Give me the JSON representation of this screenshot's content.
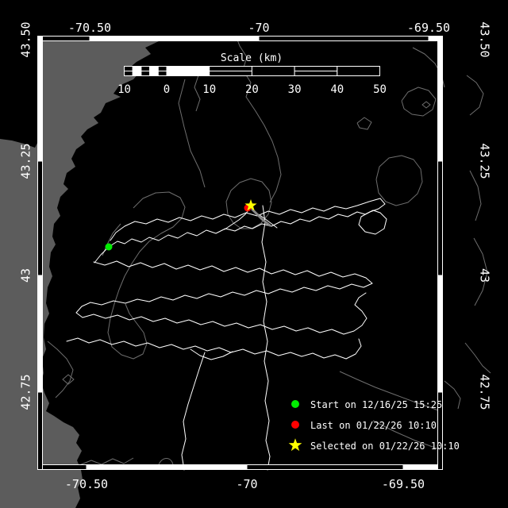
{
  "map_type": "track-map",
  "axis": {
    "top": [
      "-70.50",
      "-70",
      "-69.50"
    ],
    "bottom": [
      "-70.50",
      "-70",
      "-69.50"
    ],
    "left": [
      "43.50",
      "43.25",
      "43",
      "42.75"
    ],
    "right": [
      "43.50",
      "43.25",
      "43",
      "42.75"
    ]
  },
  "scalebar": {
    "title": "Scale (km)",
    "labels": [
      "10",
      "0",
      "10",
      "20",
      "30",
      "40",
      "50"
    ]
  },
  "legend": {
    "items": [
      {
        "marker": "start-dot",
        "shape": "circle",
        "color": "#00ee00",
        "label": "Start on 12/16/25 15:25"
      },
      {
        "marker": "last-dot",
        "shape": "circle",
        "color": "#ff0000",
        "label": "Last on 01/22/26 10:10"
      },
      {
        "marker": "selected-star",
        "shape": "star",
        "color": "#ffff00",
        "label": "Selected on 01/22/26 10:10"
      }
    ]
  },
  "markers": {
    "start": {
      "shape": "circle",
      "color": "#00ee00"
    },
    "last": {
      "shape": "circle",
      "color": "#ff0000"
    },
    "selected": {
      "shape": "star",
      "color": "#ffff00"
    }
  },
  "colors": {
    "background": "#000000",
    "land": "#5c5c5c",
    "contour": "#6e6e6e",
    "track": "#ffffff",
    "frame": "#ffffff",
    "text": "#ffffff"
  }
}
